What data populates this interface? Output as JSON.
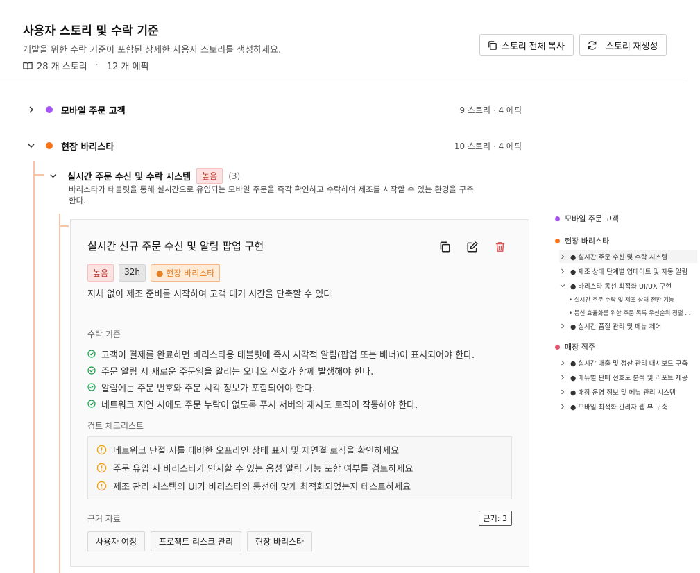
{
  "header": {
    "title": "사용자 스토리 및 수락 기준",
    "description": "개발을 위한 수락 기준이 포함된 상세한 사용자 스토리를 생성하세요.",
    "story_count": "28 개 스토리",
    "epic_count": "12 개 에픽",
    "copy_all_label": "스토리 전체 복사",
    "regenerate_label": "스토리 재생성"
  },
  "groups": [
    {
      "name": "모바일 주문 고객",
      "count": "9 스토리 · 4 에픽",
      "color": "#a855f7",
      "expanded": false
    },
    {
      "name": "현장 바리스타",
      "count": "10 스토리 · 4 에픽",
      "color": "#f97316",
      "expanded": true
    }
  ],
  "epic": {
    "title": "실시간 주문 수신 및 수락 시스템",
    "priority": "높음",
    "count": "(3)",
    "description": "바리스타가 태블릿을 통해 실시간으로 유입되는 모바일 주문을 즉각 확인하고 수락하여 제조를 시작할 수 있는 환경을 구축한다."
  },
  "story": {
    "title": "실시간 신규 주문 수신 및 알림 팝업 구현",
    "priority": "높음",
    "hours": "32h",
    "role": "● 현장 바리스타",
    "summary": "지체 없이 제조 준비를 시작하여 고객 대기 시간을 단축할 수 있다",
    "criteria_label": "수락 기준",
    "criteria": [
      "고객이 결제를 완료하면 바리스타용 태블릿에 즉시 시각적 알림(팝업 또는 배너)이 표시되어야 한다.",
      "주문 알림 시 새로운 주문임을 알리는 오디오 신호가 함께 발생해야 한다.",
      "알림에는 주문 번호와 주문 시각 정보가 포함되어야 한다.",
      "네트워크 지연 시에도 주문 누락이 없도록 푸시 서버의 재시도 로직이 작동해야 한다."
    ],
    "checklist_label": "검토 체크리스트",
    "checklist": [
      "네트워크 단절 시를 대비한 오프라인 상태 표시 및 재연결 로직을 확인하세요",
      "주문 유입 시 바리스타가 인지할 수 있는 음성 알림 기능 포함 여부를 검토하세요",
      "제조 관리 시스템의 UI가 바리스타의 동선에 맞게 최적화되었는지 테스트하세요"
    ],
    "refs_label": "근거 자료",
    "refs_count": "근거: 3",
    "refs": [
      "사용자 여정",
      "프로젝트 리스크 관리",
      "현장 바리스타"
    ]
  },
  "nav": {
    "groups": [
      {
        "name": "모바일 주문 고객",
        "color": "#a855f7"
      },
      {
        "name": "현장 바리스타",
        "color": "#f97316"
      },
      {
        "name": "매장 점주",
        "color": "#e5566f"
      }
    ],
    "barista_items": [
      "● 실시간 주문 수신 및 수락 시스템",
      "● 제조 상태 단계별 업데이트 및 자동 알림",
      "● 바리스타 동선 최적화 UI/UX 구현",
      "● 실시간 품질 관리 및 메뉴 제어"
    ],
    "barista_subitems": [
      "• 실시간 주문 수락 및 제조 상태 전환 기능",
      "• 동선 효율화를 위한 주문 목록 우선순위 정렬 ..."
    ],
    "owner_items": [
      "● 실시간 매출 및 정산 관리 대시보드 구축",
      "● 메뉴별 판매 선호도 분석 및 리포트 제공",
      "● 매장 운영 정보 및 메뉴 관리 시스템",
      "● 모바일 최적화 관리자 웹 뷰 구축"
    ]
  }
}
